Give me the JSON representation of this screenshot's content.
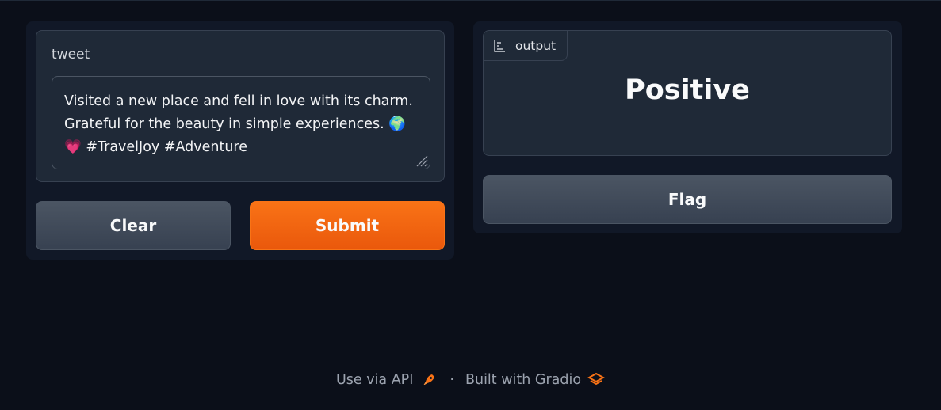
{
  "input": {
    "label": "tweet",
    "value_lines": [
      "Visited a new place and fell in love with its charm.",
      "Grateful for the beauty in simple experiences. 🌍",
      "💗 #TravelJoy #Adventure"
    ]
  },
  "buttons": {
    "clear_label": "Clear",
    "submit_label": "Submit",
    "flag_label": "Flag"
  },
  "output": {
    "tab_label": "output",
    "tab_icon": "bar-chart-icon",
    "value": "Positive"
  },
  "footer": {
    "api_label": "Use via API",
    "api_icon": "rocket-icon",
    "separator": "·",
    "built_label": "Built with Gradio",
    "gradio_icon": "gradio-logo-icon"
  },
  "colors": {
    "background": "#0b0f19",
    "panel": "#111827",
    "block": "#1f2937",
    "accent": "#f97316",
    "secondary_button": "#4b5563"
  }
}
